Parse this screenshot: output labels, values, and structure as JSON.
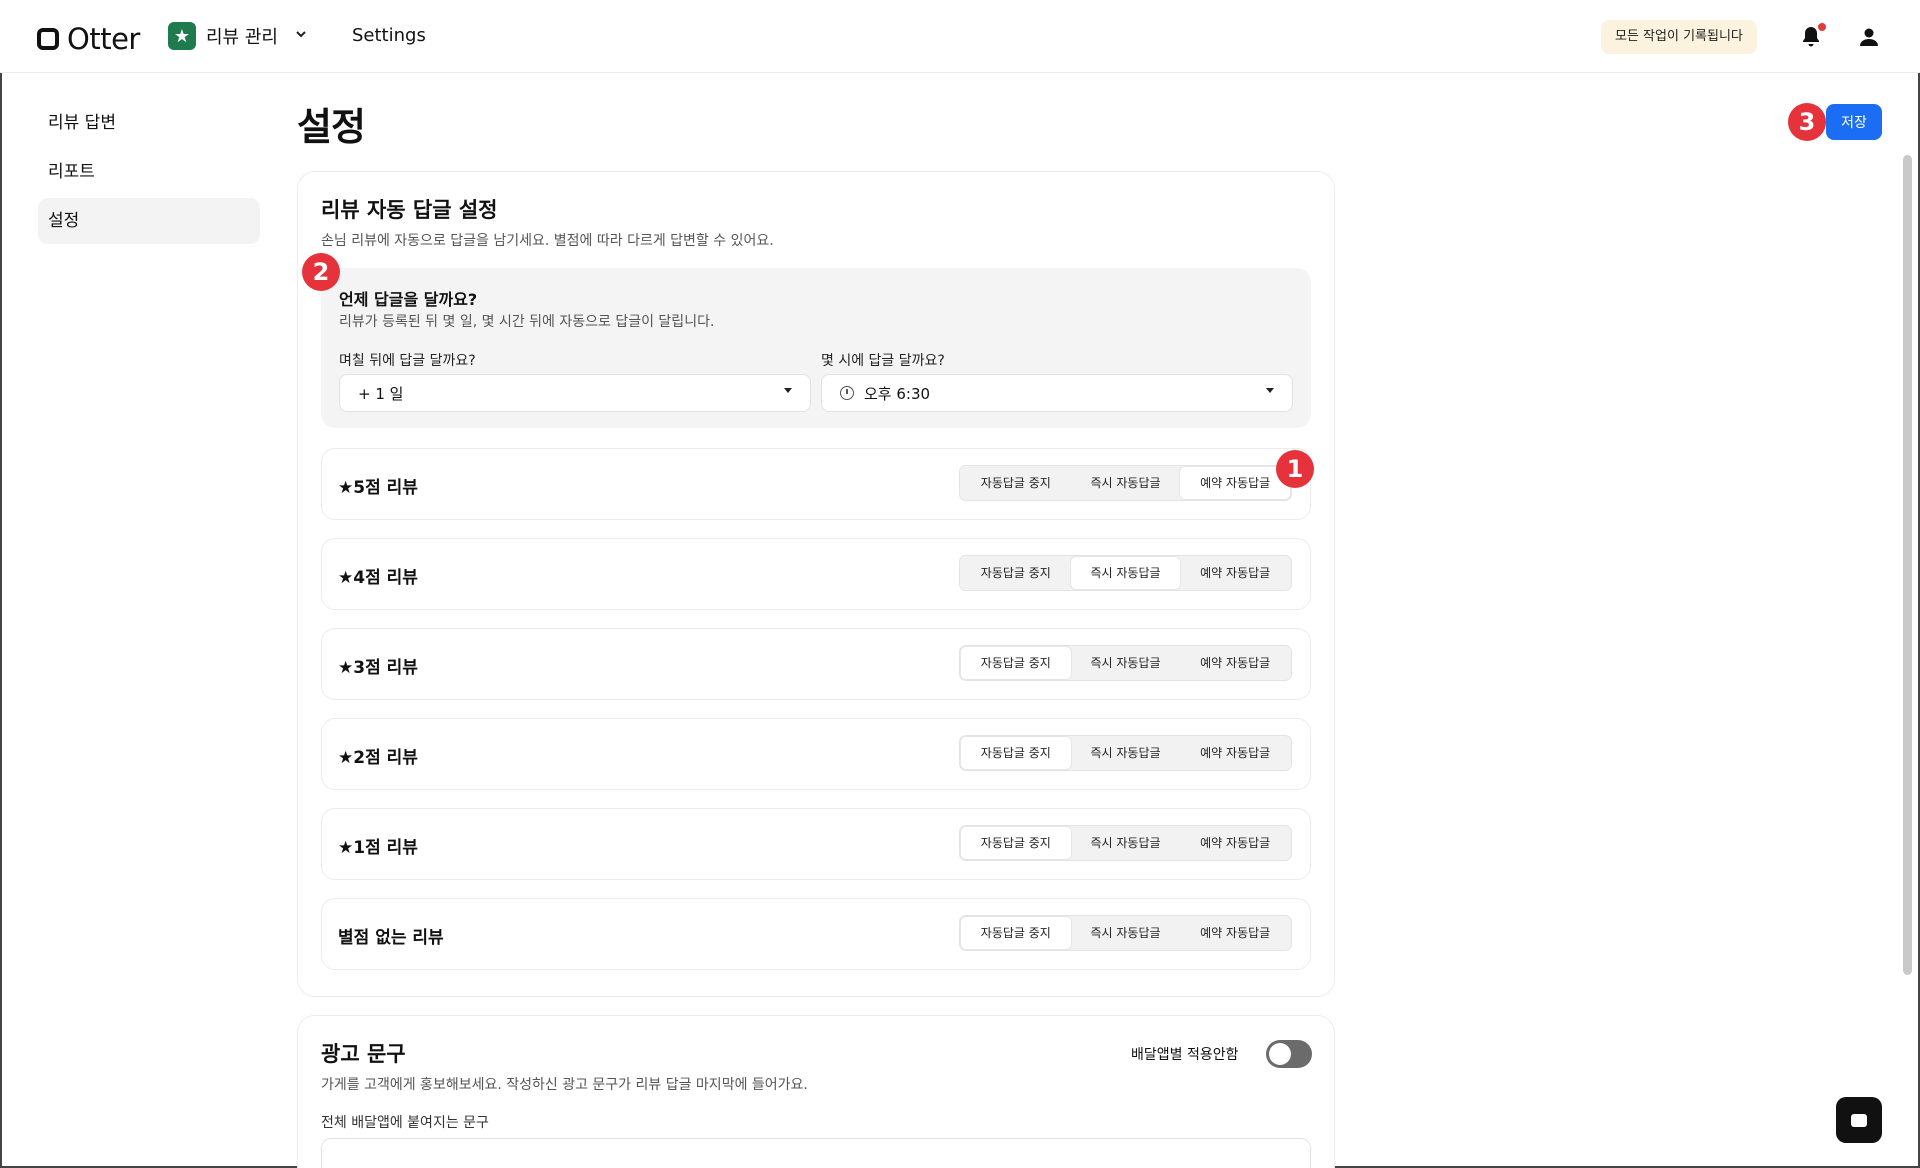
{
  "header": {
    "logo": "Otter",
    "app_name": "리뷰 관리",
    "settings_link": "Settings",
    "log_badge": "모든 작업이 기록됩니다"
  },
  "sidebar": {
    "items": [
      {
        "label": "리뷰 답변"
      },
      {
        "label": "리포트"
      },
      {
        "label": "설정",
        "active": true
      }
    ]
  },
  "page": {
    "title": "설정",
    "save_label": "저장"
  },
  "markers": [
    "1",
    "2",
    "3"
  ],
  "auto_reply": {
    "title": "리뷰 자동 답글 설정",
    "description": "손님 리뷰에 자동으로 답글을 남기세요. 별점에 따라 다르게 답변할 수 있어요.",
    "when": {
      "title": "언제 답글을 달까요?",
      "description": "리뷰가 등록된 뒤 몇 일, 몇 시간 뒤에 자동으로 답글이 달립니다.",
      "days_label": "며칠 뒤에 답글 달까요?",
      "days_value": "+ 1 일",
      "time_label": "몇 시에 답글 달까요?",
      "time_value": "오후 6:30"
    },
    "options": [
      "자동답글 중지",
      "즉시 자동답글",
      "예약 자동답글"
    ],
    "ratings": [
      {
        "label": "★5점 리뷰",
        "selected": 2
      },
      {
        "label": "★4점 리뷰",
        "selected": 1
      },
      {
        "label": "★3점 리뷰",
        "selected": 0
      },
      {
        "label": "★2점 리뷰",
        "selected": 0
      },
      {
        "label": "★1점 리뷰",
        "selected": 0
      },
      {
        "label": "별점 없는 리뷰",
        "selected": 0
      }
    ]
  },
  "ad": {
    "title": "광고 문구",
    "description": "가게를 고객에게 홍보해보세요. 작성하신 광고 문구가 리뷰 답글 마지막에 들어가요.",
    "toggle_label": "배달앱별 적용안함",
    "toggle_on": false,
    "field_label": "전체 배달앱에 붙여지는 문구"
  },
  "colors": {
    "accent": "#1b6ef3",
    "marker": "#e5323b",
    "badge_bg": "#fbf3dd",
    "app_icon": "#1f7a4d"
  },
  "icons": [
    "star-icon",
    "chevron-down-icon",
    "bell-icon",
    "user-icon",
    "clock-icon",
    "chat-icon"
  ]
}
